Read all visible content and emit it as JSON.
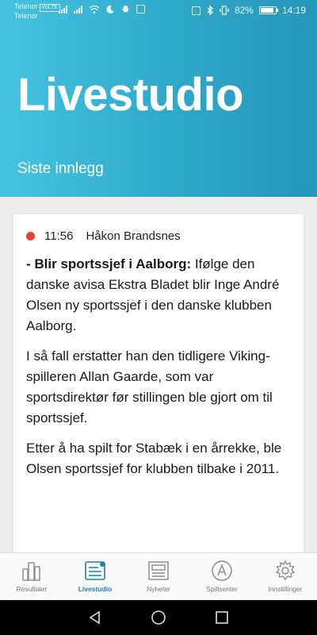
{
  "status_bar": {
    "carrier_1": "Telenor",
    "volte": "VoLTE",
    "carrier_2": "Telenor",
    "battery": "82%",
    "time": "14:19"
  },
  "header": {
    "title": "Livestudio",
    "subtitle": "Siste innlegg",
    "colors": {
      "gradient_start": "#45c4e0",
      "gradient_end": "#2596bb"
    }
  },
  "post": {
    "time": "11:56",
    "author": "Håkon Brandsnes",
    "live_color": "#e8432b",
    "lead": "- Blir sportssjef i Aalborg:",
    "paragraph_1_rest": " Ifølge den danske avisa Ekstra Bladet blir Inge André Olsen ny sportssjef i den danske klubben Aalborg.",
    "paragraph_2": "I så fall erstatter han den tidligere Viking-spilleren Allan Gaarde, som var sportsdirektør før stillingen ble gjort om til sportssjef.",
    "paragraph_3": "Etter å ha spilt for Stabæk i en årrekke, ble Olsen sportssjef for klubben tilbake i 2011."
  },
  "tabs": [
    {
      "label": "Resultater",
      "icon": "bar-chart-icon",
      "active": false
    },
    {
      "label": "Livestudio",
      "icon": "livestudio-icon",
      "active": true
    },
    {
      "label": "Nyheter",
      "icon": "newspaper-icon",
      "active": false
    },
    {
      "label": "Spillsenter",
      "icon": "spillsenter-icon",
      "active": false
    },
    {
      "label": "Innstillinger",
      "icon": "gear-icon",
      "active": false
    }
  ],
  "accent_color": "#1683b0"
}
